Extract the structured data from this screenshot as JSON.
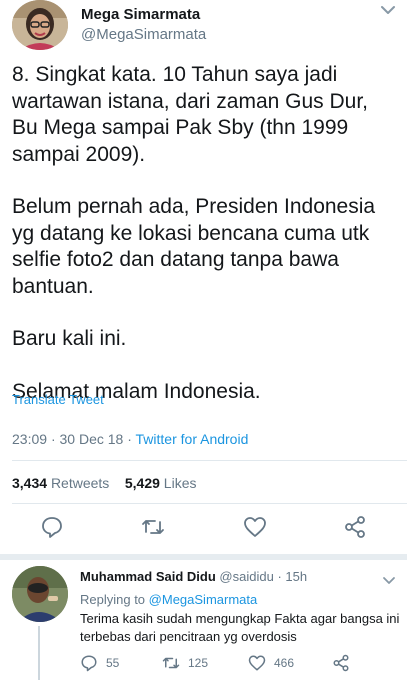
{
  "tweet": {
    "author_name": "Mega Simarmata",
    "author_handle": "@MegaSimarmata",
    "paragraphs": [
      "8. Singkat kata. 10 Tahun saya jadi wartawan istana, dari zaman Gus Dur, Bu Mega sampai Pak Sby (thn 1999 sampai 2009).",
      "Belum pernah ada, Presiden Indonesia yg datang ke lokasi bencana cuma utk selfie foto2 dan datang tanpa bawa bantuan.",
      "Baru kali ini.",
      "Selamat malam Indonesia."
    ],
    "translate_label": "Translate Tweet",
    "time": "23:09",
    "date": "30 Dec 18",
    "via": "Twitter for Android",
    "retweets_count": "3,434",
    "retweets_label": "Retweets",
    "likes_count": "5,429",
    "likes_label": "Likes"
  },
  "reply": {
    "author_name": "Muhammad Said Didu",
    "author_handle": "@saididu",
    "time_ago": "15h",
    "replying_to_label": "Replying to",
    "replying_to_handle": "@MegaSimarmata",
    "text": "Terima kasih sudah mengungkap Fakta agar bangsa ini terbebas dari pencitraan yg overdosis",
    "replies": "55",
    "retweets": "125",
    "likes": "466"
  },
  "icons": {
    "main_actions": [
      "reply-icon",
      "retweet-icon",
      "like-icon",
      "share-icon"
    ],
    "reply_actions": [
      "reply-icon",
      "retweet-icon",
      "like-icon",
      "share-icon"
    ],
    "menu": "chevron-down-icon"
  },
  "colors": {
    "link": "#1b95e0",
    "secondary_text": "#657786",
    "primary_text": "#14171a",
    "divider": "#e1e8ed"
  }
}
